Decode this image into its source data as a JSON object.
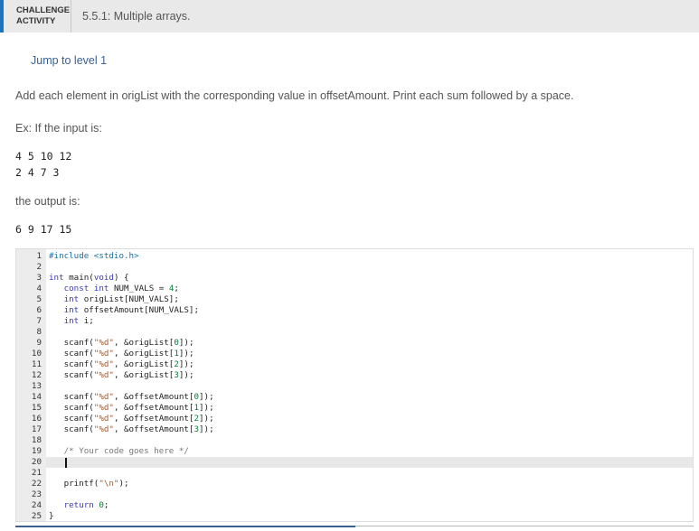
{
  "header": {
    "badge_line1": "CHALLENGE",
    "badge_line2": "ACTIVITY",
    "title": "5.5.1: Multiple arrays."
  },
  "jump_link": "Jump to level 1",
  "instructions": "Add each element in origList with the corresponding value in offsetAmount. Print each sum followed by a space.",
  "example": {
    "intro": "Ex: If the input is:",
    "input_line1": "4 5 10 12",
    "input_line2": "2 4 7 3",
    "output_intro": "the output is:",
    "output": "6 9 17 15"
  },
  "editor": {
    "active_line": 20,
    "lines": [
      "#include <stdio.h>",
      "",
      "int main(void) {",
      "   const int NUM_VALS = 4;",
      "   int origList[NUM_VALS];",
      "   int offsetAmount[NUM_VALS];",
      "   int i;",
      "",
      "   scanf(\"%d\", &origList[0]);",
      "   scanf(\"%d\", &origList[1]);",
      "   scanf(\"%d\", &origList[2]);",
      "   scanf(\"%d\", &origList[3]);",
      "",
      "   scanf(\"%d\", &offsetAmount[0]);",
      "   scanf(\"%d\", &offsetAmount[1]);",
      "   scanf(\"%d\", &offsetAmount[2]);",
      "   scanf(\"%d\", &offsetAmount[3]);",
      "",
      "   /* Your code goes here */",
      "",
      "",
      "   printf(\"\\n\");",
      "",
      "   return 0;",
      "}"
    ]
  }
}
